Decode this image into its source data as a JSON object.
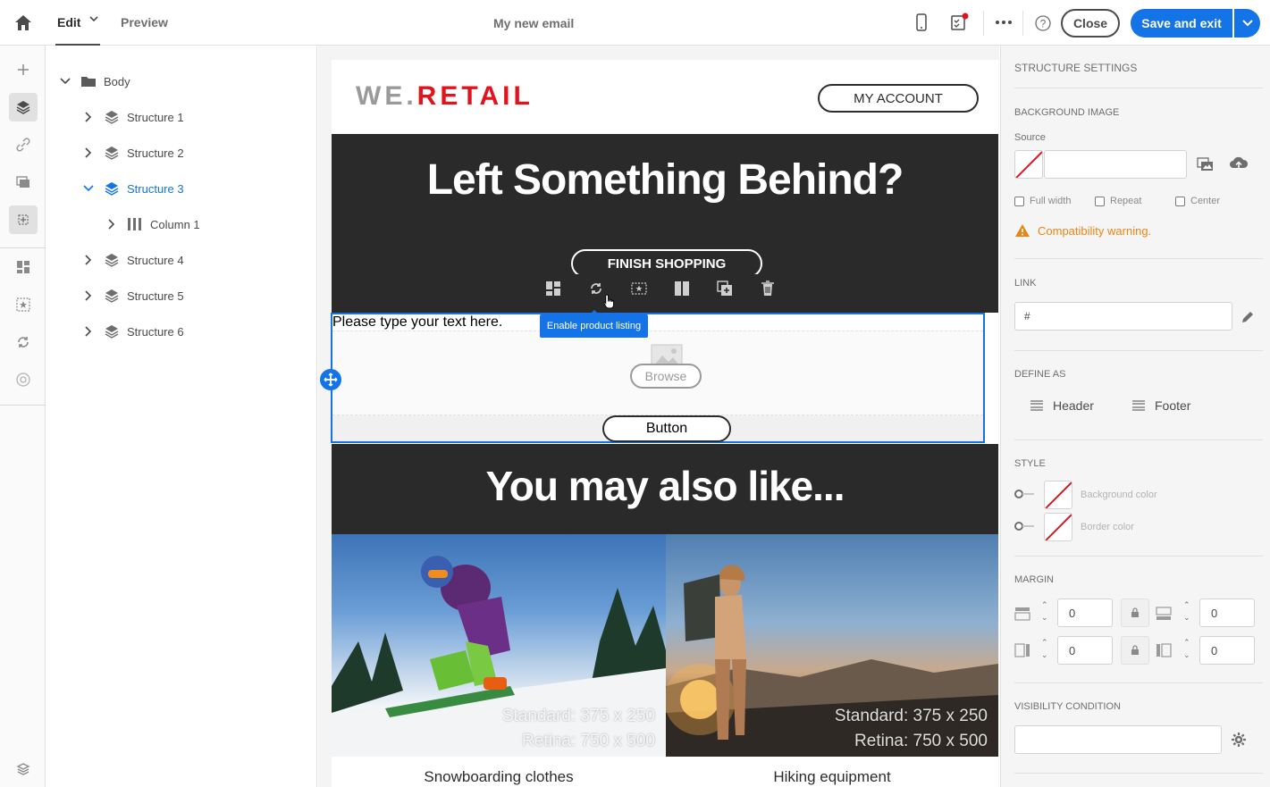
{
  "topbar": {
    "tabs": [
      {
        "label": "Edit"
      },
      {
        "label": "Preview"
      }
    ],
    "document_title": "My new email",
    "close_label": "Close",
    "save_label": "Save and exit",
    "icons": [
      "home-icon",
      "chevron-down-icon",
      "mobile-preview-icon",
      "checklist-icon",
      "more-icon",
      "help-icon",
      "chevron-down-icon"
    ]
  },
  "rail": {
    "icons": [
      "add-icon",
      "layers-icon",
      "link-icon",
      "images-icon",
      "fragments-icon",
      "content-components-icon",
      "dynamic-content-icon",
      "product-listing-icon",
      "personalization-icon",
      "versions-icon"
    ],
    "active": "fragments-icon"
  },
  "tree": {
    "root": "Body",
    "items": [
      {
        "label": "Structure 1"
      },
      {
        "label": "Structure 2"
      },
      {
        "label": "Structure 3"
      },
      {
        "label": "Column 1"
      },
      {
        "label": "Structure 4"
      },
      {
        "label": "Structure 5"
      },
      {
        "label": "Structure 6"
      }
    ],
    "selected": "Structure 3"
  },
  "email": {
    "logo_we": "WE.",
    "logo_retail": "RETAIL",
    "account_label": "MY ACCOUNT",
    "hero_title": "Left Something Behind?",
    "finish_label": "FINISH SHOPPING",
    "tooltip": "Enable product listing",
    "placeholder_text": "Please type your text here.",
    "browse_label": "Browse",
    "button_label": "Button",
    "like_title": "You may also like...",
    "products": [
      {
        "name": "Snowboarding clothes",
        "cap1": "Standard: 375 x 250",
        "cap2": "Retina: 750 x 500"
      },
      {
        "name": "Hiking equipment",
        "cap1": "Standard: 375 x 250",
        "cap2": "Retina: 750 x 500"
      }
    ],
    "toolbar_icons": [
      "layout-icon",
      "product-listing-icon",
      "fragment-icon",
      "columns-icon",
      "duplicate-icon",
      "delete-icon"
    ]
  },
  "props": {
    "title": "STRUCTURE SETTINGS",
    "bg_image": {
      "title": "BACKGROUND IMAGE",
      "source_label": "Source",
      "source_value": "",
      "checkboxes": [
        "Full width",
        "Repeat",
        "Center"
      ],
      "warning": "Compatibility warning."
    },
    "link": {
      "title": "LINK",
      "value": "#"
    },
    "define": {
      "title": "DEFINE AS",
      "header": "Header",
      "footer": "Footer"
    },
    "style": {
      "title": "STYLE",
      "background": "Background color",
      "border": "Border color"
    },
    "margin": {
      "title": "MARGIN",
      "top": "0",
      "bottom": "0",
      "left": "0",
      "right": "0"
    },
    "visibility": {
      "title": "VISIBILITY CONDITION",
      "value": ""
    }
  },
  "colors": {
    "accent": "#1473e6",
    "brand_red": "#e0141e",
    "warning": "#e68619",
    "dark_band": "#2a2a2a"
  }
}
